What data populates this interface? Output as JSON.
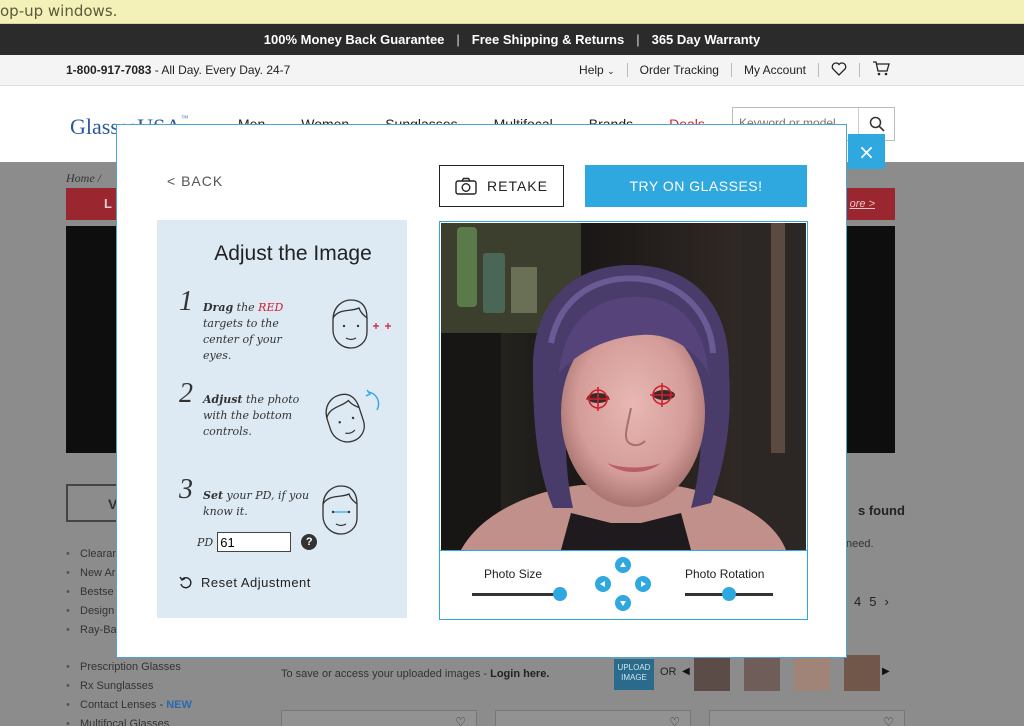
{
  "browser_notice": "op-up windows.",
  "promo": {
    "item1": "100% Money Back Guarantee",
    "item2": "Free Shipping & Returns",
    "item3": "365 Day Warranty",
    "separator": "|"
  },
  "contact": {
    "phone": "1-800-917-7083",
    "hours": " - All Day. Every Day. 24-7"
  },
  "utility": {
    "help": "Help",
    "order_tracking": "Order Tracking",
    "my_account": "My Account"
  },
  "nav": {
    "logo": "GlassesUSA",
    "items": [
      "Men",
      "Women",
      "Sunglasses",
      "Multifocal",
      "Brands",
      "Deals"
    ],
    "search_placeholder": "Keyword or model"
  },
  "background": {
    "breadcrumb": "Home /",
    "banner_left": "L",
    "banner_more": "ore >",
    "filter_label": "V",
    "left_links": [
      "Clearan",
      "New Ar",
      "Bestse",
      "Design",
      "Ray-Ba"
    ],
    "left_links2": [
      "Prescription Glasses",
      "Rx Sunglasses",
      "Contact Lenses - ",
      "Multifocal Glasses"
    ],
    "new_badge": "NEW",
    "results_found": "s found",
    "need_text": "need.",
    "pages": [
      "4",
      "5",
      "›"
    ],
    "upload_prompt": "To save or access your uploaded images - ",
    "login_link": "Login here.",
    "upload_button": "UPLOAD IMAGE",
    "or_text": "OR"
  },
  "modal": {
    "close": "×",
    "back": "< BACK",
    "retake": "RETAKE",
    "try_on": "TRY ON GLASSES!",
    "panel_title": "Adjust the Image",
    "steps": [
      {
        "num": "1",
        "bold": "Drag",
        "pre": " the ",
        "red": "RED",
        "rest": " targets to the center of your eyes."
      },
      {
        "num": "2",
        "bold": "Adjust",
        "rest": " the photo with the bottom controls."
      },
      {
        "num": "3",
        "bold": "Set",
        "rest": " your PD, if you know it."
      }
    ],
    "pd_label": "PD",
    "pd_value": "61",
    "help_icon": "?",
    "reset": "Reset Adjustment",
    "photo_size_label": "Photo Size",
    "photo_rotation_label": "Photo Rotation",
    "photo_size_level": 0.98,
    "photo_rotation_level": 0.5,
    "accent_color": "#2fa8e0",
    "target_color": "#d0202f"
  }
}
